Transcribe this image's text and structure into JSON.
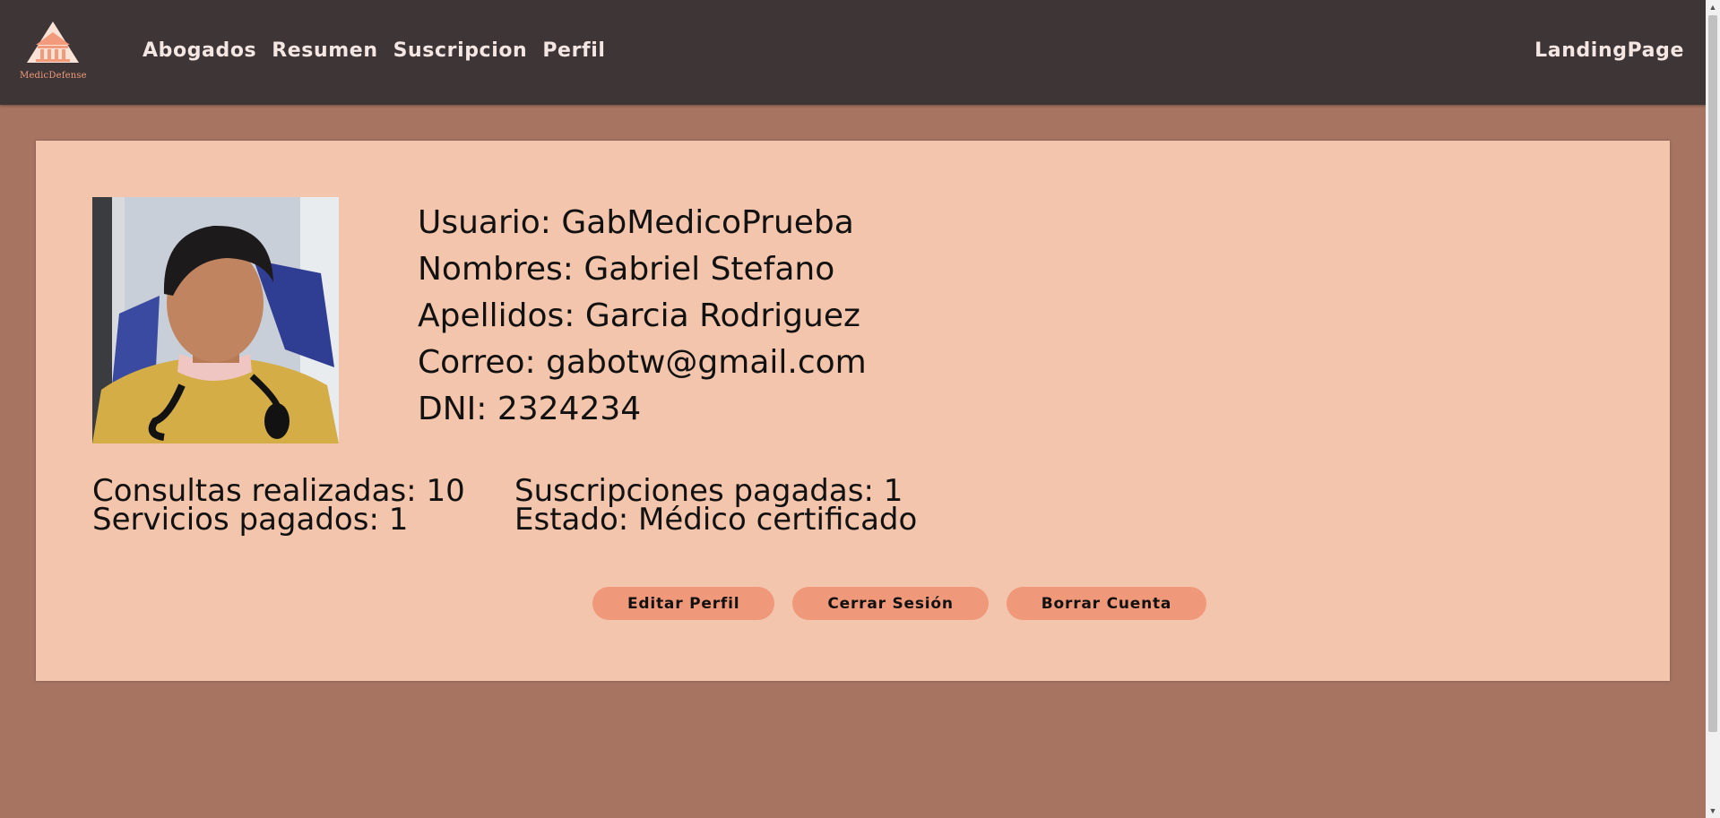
{
  "brand": {
    "logo_text": "MedicDefense"
  },
  "nav": {
    "links": [
      "Abogados",
      "Resumen",
      "Suscripcion",
      "Perfil"
    ],
    "right_link": "LandingPage"
  },
  "profile": {
    "photo_icon": "user-photo",
    "fields": [
      "Usuario: GabMedicoPrueba",
      "Nombres: Gabriel Stefano",
      "Apellidos: Garcia Rodriguez",
      "Correo: gabotw@gmail.com",
      "DNI: 2324234"
    ],
    "stats_left": [
      "Consultas realizadas: 10",
      "Servicios pagados: 1"
    ],
    "stats_right": [
      "Suscripciones pagadas: 1",
      "Estado: Médico certificado"
    ]
  },
  "actions": {
    "edit": "Editar Perfil",
    "logout": "Cerrar Sesión",
    "delete": "Borrar Cuenta"
  },
  "colors": {
    "navbar": "#3d3536",
    "page_bg": "#a67461",
    "card_bg": "#f2c5ac",
    "button_bg": "#f0987a",
    "nav_text": "#f4e6e2",
    "accent": "#f29a7c"
  }
}
